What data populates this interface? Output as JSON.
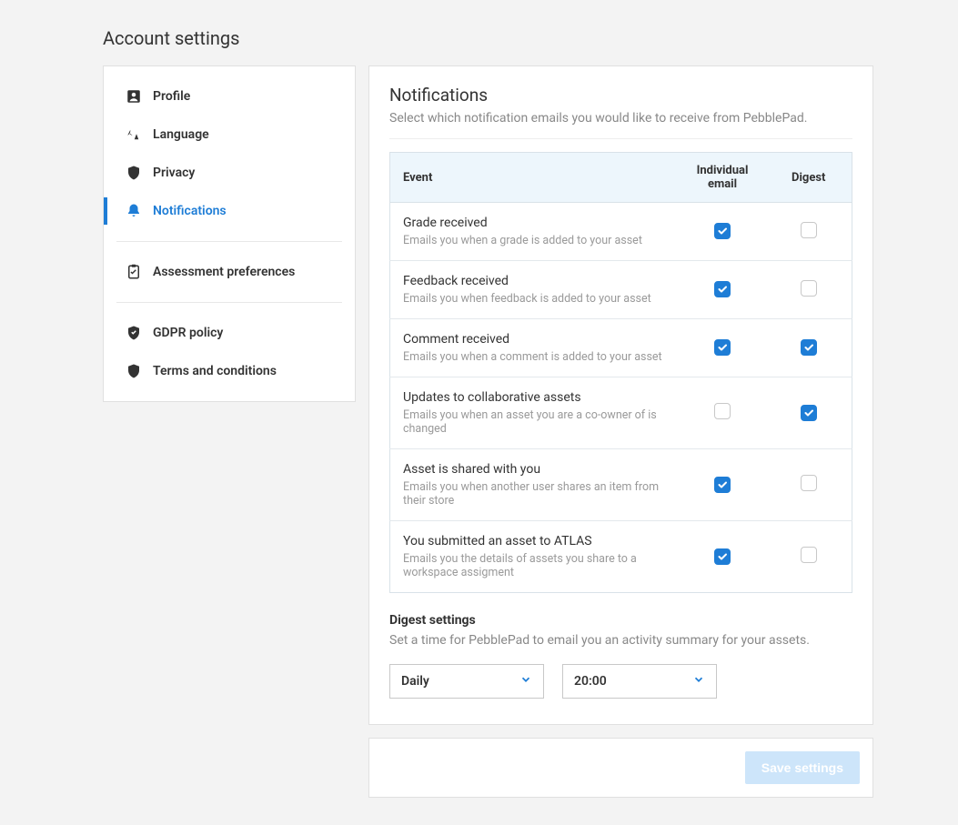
{
  "pageTitle": "Account settings",
  "sidebar": {
    "items": [
      {
        "label": "Profile",
        "active": false
      },
      {
        "label": "Language",
        "active": false
      },
      {
        "label": "Privacy",
        "active": false
      },
      {
        "label": "Notifications",
        "active": true
      },
      {
        "label": "Assessment preferences",
        "active": false
      },
      {
        "label": "GDPR policy",
        "active": false
      },
      {
        "label": "Terms and conditions",
        "active": false
      }
    ]
  },
  "main": {
    "title": "Notifications",
    "description": "Select which notification emails you would like to receive from PebblePad.",
    "columns": {
      "event": "Event",
      "individual": "Individual email",
      "digest": "Digest"
    },
    "rows": [
      {
        "title": "Grade received",
        "desc": "Emails you when a grade is added to your asset",
        "individual": true,
        "digest": false
      },
      {
        "title": "Feedback received",
        "desc": "Emails you when feedback is added to your asset",
        "individual": true,
        "digest": false
      },
      {
        "title": "Comment received",
        "desc": "Emails you when a comment is added to your asset",
        "individual": true,
        "digest": true
      },
      {
        "title": "Updates to collaborative assets",
        "desc": "Emails you when an asset you are a co-owner of is changed",
        "individual": false,
        "digest": true
      },
      {
        "title": "Asset is shared with you",
        "desc": "Emails you when another user shares an item from their store",
        "individual": true,
        "digest": false
      },
      {
        "title": "You submitted an asset to ATLAS",
        "desc": "Emails you the details of assets you share to a workspace assigment",
        "individual": true,
        "digest": false
      }
    ],
    "digestSettings": {
      "heading": "Digest settings",
      "desc": "Set a time for PebblePad to email you an activity summary for your assets.",
      "frequency": "Daily",
      "time": "20:00"
    }
  },
  "footer": {
    "saveLabel": "Save settings"
  }
}
